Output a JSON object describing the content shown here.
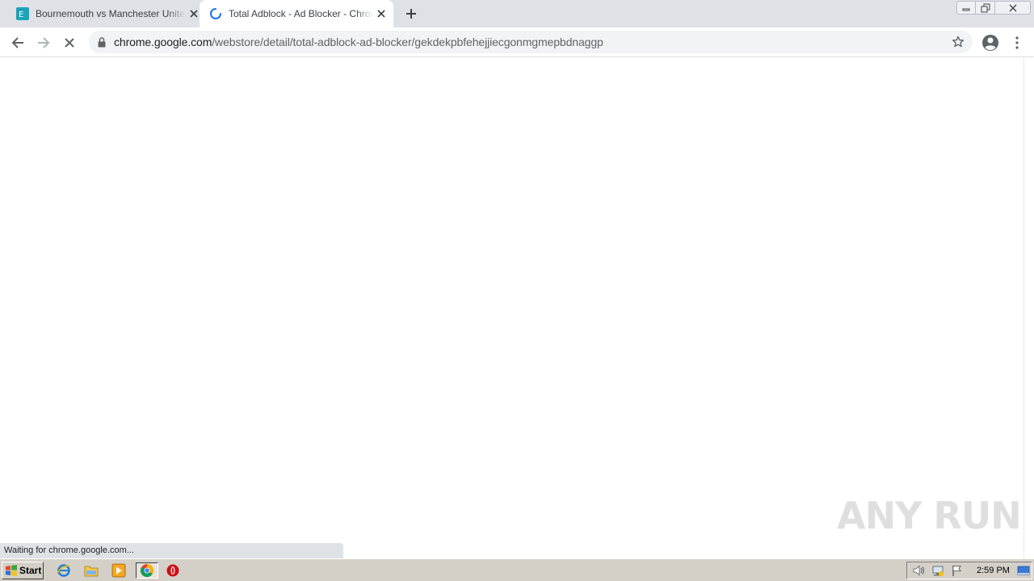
{
  "browser": {
    "tabs": [
      {
        "title": "Bournemouth vs Manchester United Live S",
        "active": false,
        "favicon": "site-logo-icon"
      },
      {
        "title": "Total Adblock - Ad Blocker - Chrome Web",
        "active": true,
        "favicon": "loading-spinner-icon"
      }
    ],
    "address": {
      "host": "chrome.google.com",
      "path": "/webstore/detail/total-adblock-ad-blocker/gekdekpbfehejjiecgonmgmepbdnaggp"
    },
    "status_text": "Waiting for chrome.google.com...",
    "accent": "#1a73e8"
  },
  "watermark": {
    "text": "ANY RUN"
  },
  "taskbar": {
    "start_label": "Start",
    "clock": "2:59 PM",
    "pinned": [
      "internet-explorer-icon",
      "file-explorer-icon",
      "media-player-icon",
      "chrome-icon",
      "opera-icon"
    ]
  }
}
